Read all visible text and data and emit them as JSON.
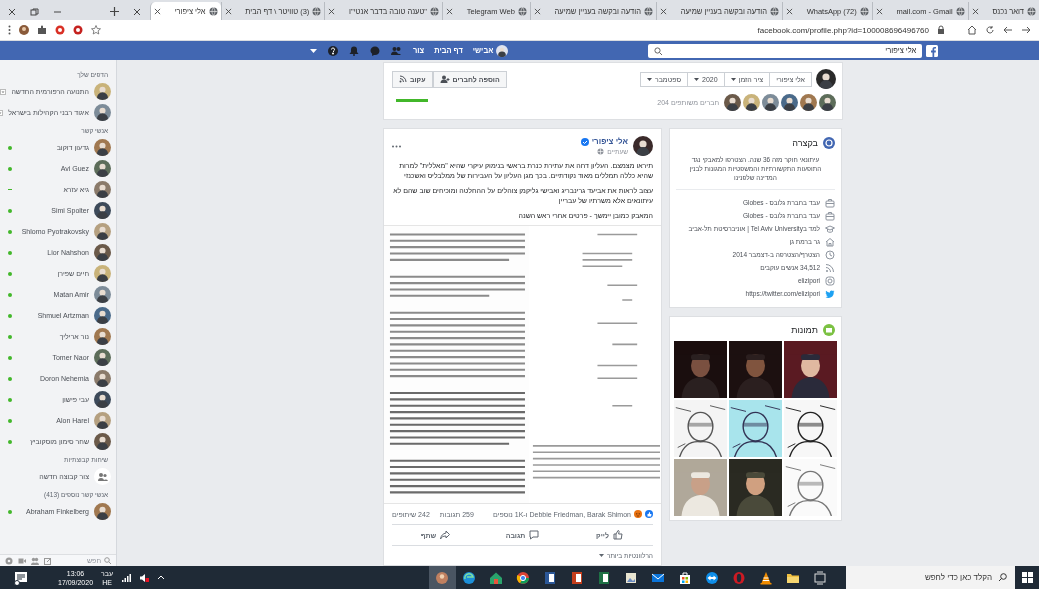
{
  "browser": {
    "tabs": [
      {
        "label": "דואר נכנס",
        "selected": false
      },
      {
        "label": "mail.com - Gmail",
        "selected": false
      },
      {
        "label": "(72) WhatsApp",
        "selected": false
      },
      {
        "label": "הודעה ובקשה בעניין שמיעה",
        "selected": false
      },
      {
        "label": "הודעה ובקשה בעניין שמיעה",
        "selected": false
      },
      {
        "label": "Telegram Web",
        "selected": false
      },
      {
        "label": "\"טענה טובה בדבר אנטי\"ו",
        "selected": false
      },
      {
        "label": "(3) טוויטר \\ דף הבית",
        "selected": false
      },
      {
        "label": "אלי ציפורי",
        "selected": true
      }
    ],
    "address": "facebook.com/profile.php?id=100008696496760"
  },
  "facebook_bar": {
    "search": {
      "value": "אלי ציפורי"
    },
    "nav": [
      {
        "label": "אבישי",
        "kind": "profile"
      },
      {
        "label": "דף הבית",
        "kind": "link"
      },
      {
        "label": "צור",
        "kind": "link"
      }
    ]
  },
  "chat_sidebar": {
    "items": [
      {
        "kind": "heading",
        "label": "הדפים שלך"
      },
      {
        "kind": "page",
        "label": "התנועה הרפורמית החדשה"
      },
      {
        "kind": "page",
        "label": "איגוד רבני הקהילות בישראל"
      },
      {
        "kind": "heading",
        "label": "אנשי קשר"
      },
      {
        "kind": "contact",
        "label": "גדעון דוקוב",
        "online": true
      },
      {
        "kind": "contact",
        "label": "Avi Guez",
        "online": true
      },
      {
        "kind": "contact",
        "label": "גיא עזרא",
        "online": false
      },
      {
        "kind": "contact",
        "label": "Simi Spolter",
        "online": true
      },
      {
        "kind": "contact",
        "label": "Shlomo Pyotrakovsky",
        "online": true
      },
      {
        "kind": "contact",
        "label": "Lior Nahshon",
        "online": true
      },
      {
        "kind": "contact",
        "label": "חיים שפירן",
        "online": true
      },
      {
        "kind": "contact",
        "label": "Matan Amir",
        "online": true
      },
      {
        "kind": "contact",
        "label": "Shmuel Artzman",
        "online": true
      },
      {
        "kind": "contact",
        "label": "נור אריליך",
        "online": true
      },
      {
        "kind": "contact",
        "label": "Tomer Naor",
        "online": true
      },
      {
        "kind": "contact",
        "label": "Doron Nehemia",
        "online": true
      },
      {
        "kind": "contact",
        "label": "עבי פישון",
        "online": true
      },
      {
        "kind": "contact",
        "label": "Alon Harel",
        "online": true
      },
      {
        "kind": "contact",
        "label": "שחר סימון מוסקוביץ",
        "online": true
      },
      {
        "kind": "heading",
        "label": "שיחות קבוצתיות"
      },
      {
        "kind": "action",
        "label": "צור קבוצה חדשה"
      },
      {
        "kind": "heading",
        "label": "אנשי קשר נוספים (413)"
      },
      {
        "kind": "contact",
        "label": "Abraham Finkelberg",
        "online": true
      }
    ],
    "search": {
      "placeholder": "חפש"
    }
  },
  "timeline_header": {
    "name": "אלי ציפורי",
    "dropdowns": [
      "ציר הזמן",
      "2020",
      "ספטמבר"
    ],
    "mutual_friends": "204 חברים משותפים",
    "buttons": [
      {
        "label": "הוספה לחברים",
        "kind": "add-friend"
      },
      {
        "label": "עקוב",
        "kind": "follow"
      }
    ]
  },
  "post": {
    "author": "אלי ציפורי",
    "verified": true,
    "time": "שעתיים",
    "paragraphs": [
      "תיראו מצמצם. העליון דחה את עתירת כנרת בראשי בנימוק עיקרי שהיא \"מאללית\" למרות שהיא כללה תמללים מאוד נקודתיים. בכך מגן העליון על העבירות של ממלבליס ואשכנזי",
      "עצוב לראות את אביעד גרינבריג ואבישי גליקמן צוהלים על ההחלטה ומוכיחים שוב שהם לא עיתונאים אלא משרתיו של עבריין",
      "המאבק כמובן יימשך - פרטים אחרי ראש השנה"
    ],
    "reactions": "Debbie Friedman, Barak Shimon ו-1K נוספים",
    "comments": "259 תגובות",
    "shares": "242 שיתופים",
    "actions": [
      {
        "label": "לייק",
        "kind": "like"
      },
      {
        "label": "תגובה",
        "kind": "comment"
      },
      {
        "label": "שתף",
        "kind": "share"
      }
    ],
    "sort": "הרלוונטיות ביותר"
  },
  "intro": {
    "title": "בקצרה",
    "bio": "עיתונאי חוקר מזה 36 שנה. הצטרפו למאבקי נגד התופעות התקשורתיות והמשפטיות המגונות לבנין המדינה שלפנינו",
    "items": [
      {
        "kind": "work",
        "text": "עבד בחברת גלובס - Globes"
      },
      {
        "kind": "work",
        "text": "עבד בחברת גלובס - Globes"
      },
      {
        "kind": "education",
        "text": "למד בTel Aviv University | אוניברסיטת תל-אביב"
      },
      {
        "kind": "home",
        "text": "גר ברמת גן"
      },
      {
        "kind": "joined",
        "text": "הצטרף/הצטרפה ב-דצמבר 2014"
      },
      {
        "kind": "followers",
        "text": "34,512 אנשים עוקבים"
      },
      {
        "kind": "instagram",
        "text": "elizipori"
      },
      {
        "kind": "twitter",
        "text": "https://twitter.com/elizipori"
      }
    ]
  },
  "photos": {
    "title": "תמונות"
  },
  "taskbar": {
    "search": {
      "placeholder": "הקלד כאן כדי לחפש"
    },
    "time": "13:06",
    "date": "17/09/2020",
    "language": "עבר",
    "language_code": "HE"
  }
}
